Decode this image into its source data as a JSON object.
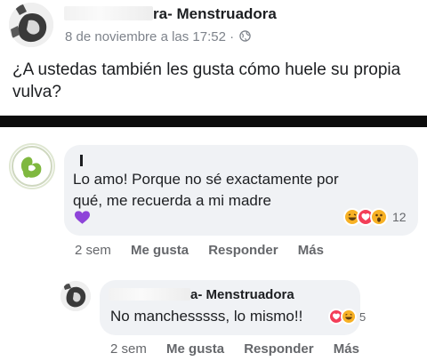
{
  "post": {
    "author_suffix": "ra- Menstruadora",
    "timestamp": "8 de noviembre a las 17:52 · ",
    "audience_icon": "globe-icon",
    "text": "¿A ustedas también les gusta cómo huele su propia vulva?"
  },
  "comment": {
    "text": "Lo amo! Porque no sé exactamente por qué, me recuerda a mi madre",
    "emoji_icon": "purple-heart-icon",
    "reactions": [
      "haha",
      "love",
      "wow"
    ],
    "reaction_count": "12",
    "actions": {
      "time": "2 sem",
      "like": "Me gusta",
      "reply": "Responder",
      "more": "Más"
    }
  },
  "reply": {
    "author_suffix": "a- Menstruadora",
    "text": "No manchesssss, lo mismo!!",
    "reactions": [
      "love",
      "haha"
    ],
    "reaction_count": "5",
    "actions": {
      "time": "2 sem",
      "like": "Me gusta",
      "reply": "Responder",
      "more": "Más"
    }
  },
  "colors": {
    "text": "#1c1e21",
    "muted": "#65676b",
    "bubble": "#f0f2f5",
    "divider": "#0c0c0c",
    "love": "#f33e58",
    "haha": "#f7b125",
    "heart_purple": "#8e44d9"
  }
}
